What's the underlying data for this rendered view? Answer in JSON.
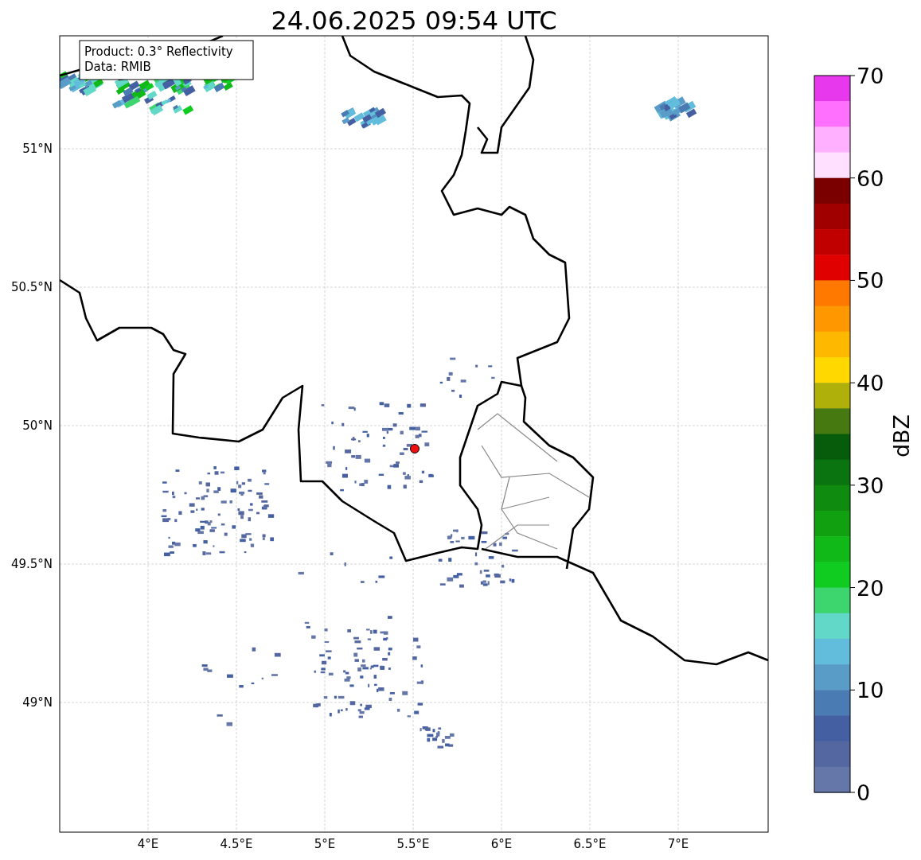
{
  "title": "24.06.2025 09:54 UTC",
  "info_box": [
    "Product: 0.3° Reflectivity",
    "Data: RMIB"
  ],
  "map": {
    "kind": "map",
    "x_ticks": [
      "4°E",
      "4.5°E",
      "5°E",
      "5.5°E",
      "6°E",
      "6.5°E",
      "7°E"
    ],
    "y_ticks": [
      "51°N",
      "50.5°N",
      "50°N",
      "49.5°N",
      "49°N"
    ]
  },
  "colorbar": {
    "label": "dBZ",
    "ticks": [
      "70",
      "60",
      "50",
      "40",
      "30",
      "20",
      "10",
      "0"
    ],
    "segments": [
      {
        "color": "#e838ee"
      },
      {
        "color": "#ff70ff"
      },
      {
        "color": "#ffb0ff"
      },
      {
        "color": "#ffe0ff"
      },
      {
        "color": "#7a0000"
      },
      {
        "color": "#a00000"
      },
      {
        "color": "#c00000"
      },
      {
        "color": "#e00000"
      },
      {
        "color": "#ff7800"
      },
      {
        "color": "#ff9800"
      },
      {
        "color": "#ffb800"
      },
      {
        "color": "#ffd800"
      },
      {
        "color": "#b0b00a"
      },
      {
        "color": "#467a10"
      },
      {
        "color": "#065c0a"
      },
      {
        "color": "#0a7410"
      },
      {
        "color": "#0f8c10"
      },
      {
        "color": "#10a010"
      },
      {
        "color": "#10b818"
      },
      {
        "color": "#10cc20"
      },
      {
        "color": "#3dd66e"
      },
      {
        "color": "#62d8c8"
      },
      {
        "color": "#62bcdc"
      },
      {
        "color": "#5a9cc8"
      },
      {
        "color": "#4a7bb2"
      },
      {
        "color": "#4560a2"
      },
      {
        "color": "#5567a0"
      },
      {
        "color": "#6577a8"
      }
    ]
  }
}
